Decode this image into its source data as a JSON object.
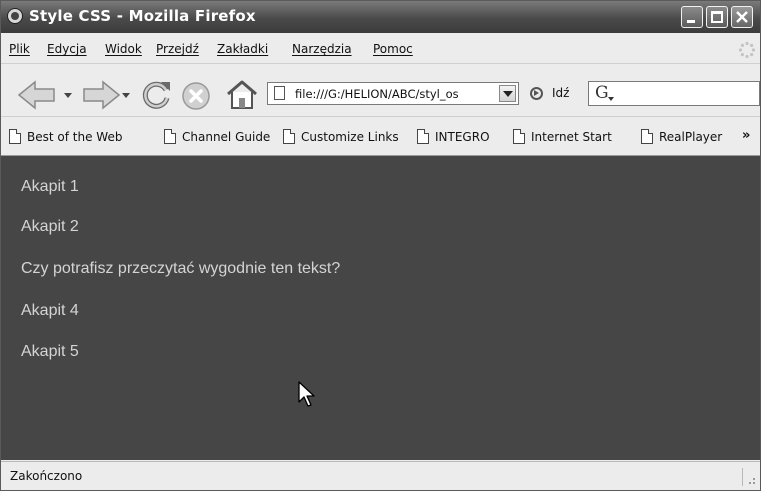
{
  "window": {
    "title": "Style CSS - Mozilla Firefox"
  },
  "menu": {
    "items": [
      "Plik",
      "Edycja",
      "Widok",
      "Przejdź",
      "Zakładki",
      "Narzędzia",
      "Pomoc"
    ]
  },
  "navigation": {
    "url": "file:///G:/HELION/ABC/styl_os",
    "go_label": "Idź",
    "search_engine_letter": "G"
  },
  "bookmarks": {
    "items": [
      "Best of the Web",
      "Channel Guide",
      "Customize Links",
      "INTEGRO",
      "Internet Start",
      "RealPlayer"
    ],
    "overflow_label": "»"
  },
  "content": {
    "background_color": "#464646",
    "text_color": "#d4d4d4",
    "paragraphs": [
      "Akapit 1",
      "Akapit 2",
      "Czy potrafisz przeczytać wygodnie ten tekst?",
      "Akapit 4",
      "Akapit 5"
    ]
  },
  "status": {
    "text": "Zakończono"
  }
}
